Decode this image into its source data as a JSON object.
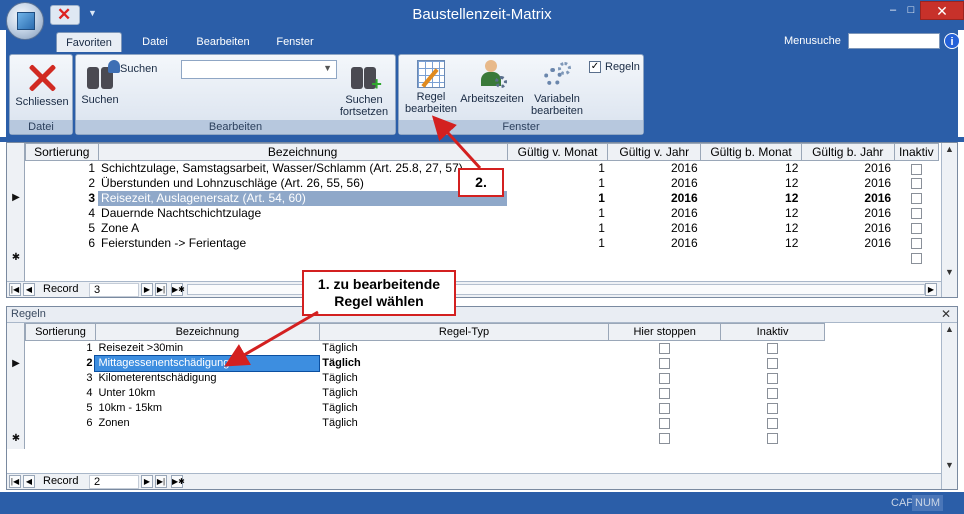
{
  "window": {
    "title": "Baustellenzeit-Matrix",
    "close_label": "✕",
    "minimize_label": "–",
    "maximize_label": "□"
  },
  "ribbon_tabs": [
    "Favoriten",
    "Datei",
    "Bearbeiten",
    "Fenster"
  ],
  "menusuche_label": "Menusuche",
  "help_label": "i",
  "groups": {
    "datei": "Datei",
    "bearbeiten": "Bearbeiten",
    "fenster": "Fenster"
  },
  "buttons": {
    "schliessen": "Schliessen",
    "suchen": "Suchen",
    "suchen_small": "Suchen",
    "suchen_fort_1": "Suchen",
    "suchen_fort_2": "fortsetzen",
    "regel_1": "Regel",
    "regel_2": "bearbeiten",
    "arbeitszeiten": "Arbeitszeiten",
    "variabeln_1": "Variabeln",
    "variabeln_2": "bearbeiten",
    "regeln_check": "Regeln"
  },
  "grid1": {
    "headers": [
      "Sortierung",
      "Bezeichnung",
      "Gültig v. Monat",
      "Gültig v. Jahr",
      "Gültig b. Monat",
      "Gültig b. Jahr",
      "Inaktiv"
    ],
    "rows": [
      [
        "1",
        "Schichtzulage, Samstagsarbeit, Wasser/Schlamm (Art. 25.8, 27, 57)",
        "1",
        "2016",
        "12",
        "2016"
      ],
      [
        "2",
        "Überstunden und Lohnzuschläge (Art. 26, 55, 56)",
        "1",
        "2016",
        "12",
        "2016"
      ],
      [
        "3",
        "Reisezeit, Auslagenersatz (Art. 54, 60)",
        "1",
        "2016",
        "12",
        "2016"
      ],
      [
        "4",
        "Dauernde Nachtschichtzulage",
        "1",
        "2016",
        "12",
        "2016"
      ],
      [
        "5",
        "Zone A",
        "1",
        "2016",
        "12",
        "2016"
      ],
      [
        "6",
        "Feierstunden -> Ferientage",
        "1",
        "2016",
        "12",
        "2016"
      ]
    ],
    "record_label": "Record",
    "record_value": "3"
  },
  "grid2": {
    "title": "Regeln",
    "headers": [
      "Sortierung",
      "Bezeichnung",
      "Regel-Typ",
      "Hier stoppen",
      "Inaktiv"
    ],
    "rows": [
      [
        "1",
        "Reisezeit >30min",
        "Täglich"
      ],
      [
        "2",
        "Mittagessenentschädigung",
        "Täglich"
      ],
      [
        "3",
        "Kilometerentschädigung",
        "Täglich"
      ],
      [
        "4",
        "Unter 10km",
        "Täglich"
      ],
      [
        "5",
        "10km - 15km",
        "Täglich"
      ],
      [
        "6",
        "Zonen",
        "Täglich"
      ]
    ],
    "record_label": "Record",
    "record_value": "2"
  },
  "callouts": {
    "c2": "2.",
    "c1_line1": "1. zu bearbeitende",
    "c1_line2": "Regel wählen"
  },
  "status": {
    "cap": "CAP",
    "num": "NUM"
  },
  "colors": {
    "accent": "#2b5ea8",
    "callout": "#d32020"
  }
}
